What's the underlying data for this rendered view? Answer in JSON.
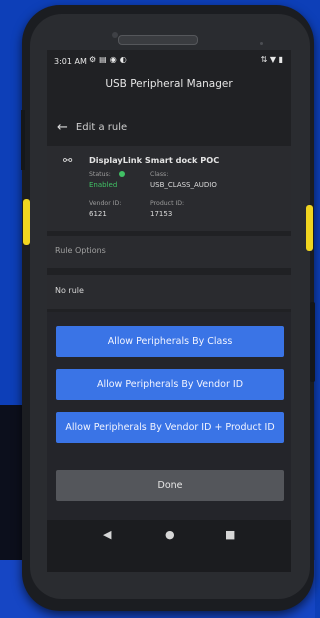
{
  "status_bar": {
    "time": "3:01 AM",
    "left_icons": [
      "gear-icon",
      "message-icon",
      "shield-icon",
      "circle-icon"
    ],
    "right_icons": "⇅ ▼ ▮"
  },
  "app": {
    "title": "USB Peripheral Manager"
  },
  "header": {
    "back_label": "Edit a rule",
    "back_icon": "←"
  },
  "device": {
    "name": "DisplayLink Smart dock POC",
    "status_label": "Status:",
    "status_value": "Enabled",
    "class_label": "Class:",
    "class_value": "USB_CLASS_AUDIO",
    "vendor_label": "Vendor ID:",
    "vendor_value": "6121",
    "product_label": "Product ID:",
    "product_value": "17153",
    "status_color": "#41c065"
  },
  "rule_options": {
    "label": "Rule Options",
    "value": "No rule"
  },
  "actions": {
    "by_class": "Allow Peripherals By Class",
    "by_vendor": "Allow Peripherals By Vendor ID",
    "by_vendor_product": "Allow Peripherals By Vendor ID + Product ID",
    "done": "Done",
    "accent": "#3a74e6"
  },
  "navbar": {
    "back": "◀",
    "home": "●",
    "recents": "■"
  }
}
